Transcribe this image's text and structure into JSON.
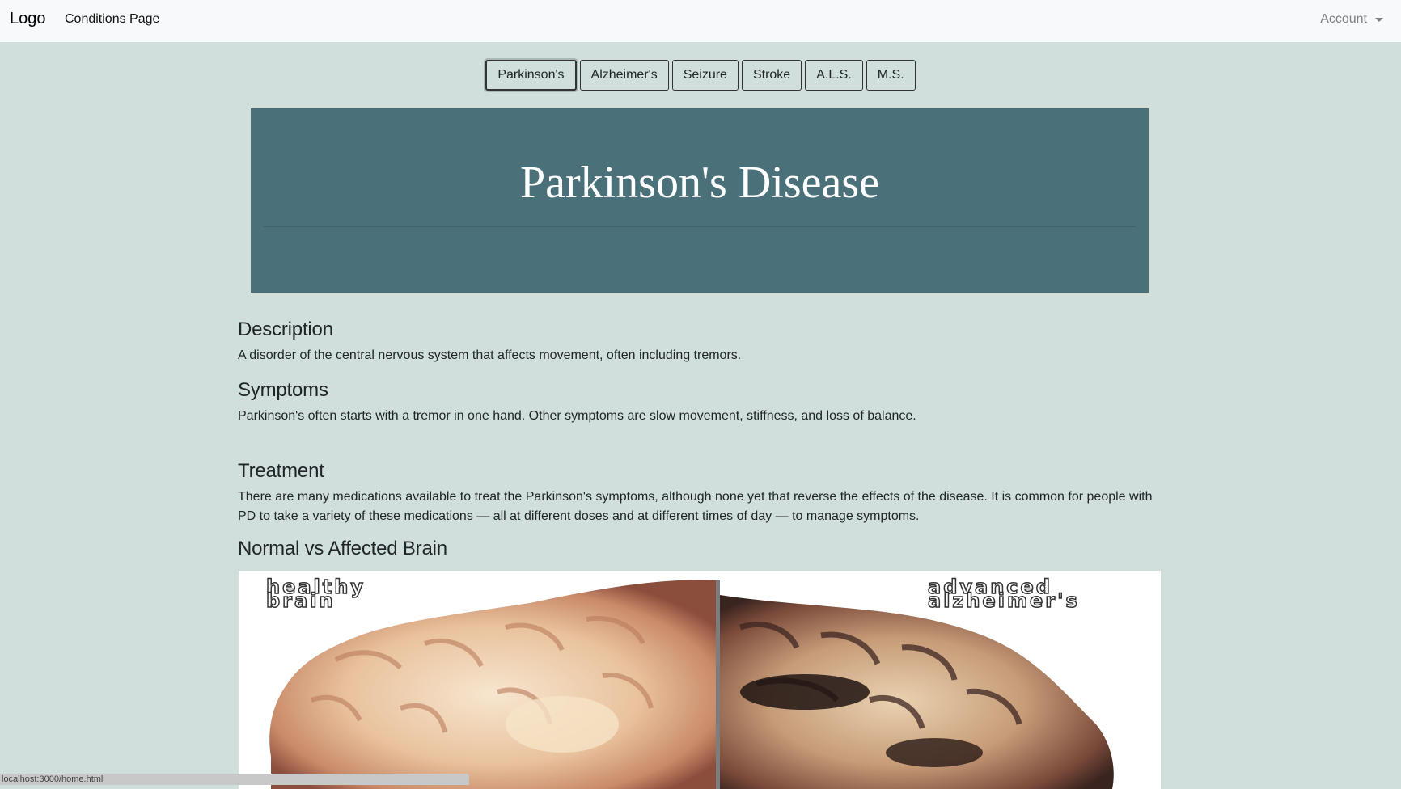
{
  "navbar": {
    "brand": "Logo",
    "link": "Conditions Page",
    "account": "Account"
  },
  "tabs": [
    {
      "label": "Parkinson's",
      "active": true
    },
    {
      "label": "Alzheimer's",
      "active": false
    },
    {
      "label": "Seizure",
      "active": false
    },
    {
      "label": "Stroke",
      "active": false
    },
    {
      "label": "A.L.S.",
      "active": false
    },
    {
      "label": "M.S.",
      "active": false
    }
  ],
  "hero": {
    "title": "Parkinson's Disease"
  },
  "sections": {
    "description": {
      "heading": "Description",
      "text": "A disorder of the central nervous system that affects movement, often including tremors."
    },
    "symptoms": {
      "heading": "Symptoms",
      "text": "Parkinson's often starts with a tremor in one hand. Other symptoms are slow movement, stiffness, and loss of balance."
    },
    "treatment": {
      "heading": "Treatment",
      "text": "There are many medications available to treat the Parkinson's symptoms, although none yet that reverse the effects of the disease. It is common for people with PD to take a variety of these medications — all at different doses and at different times of day — to manage symptoms."
    },
    "comparison": {
      "heading": "Normal vs Affected Brain"
    }
  },
  "image": {
    "label_left_line1": "healthy",
    "label_left_line2": "brain",
    "label_right_line1": "advanced",
    "label_right_line2": "alzheimer's"
  },
  "status_bar": {
    "url": "localhost:3000/home.html"
  },
  "colors": {
    "page_bg": "#d0dfdc",
    "navbar_bg": "#f8f9fa",
    "hero_bg": "#4a7079"
  }
}
